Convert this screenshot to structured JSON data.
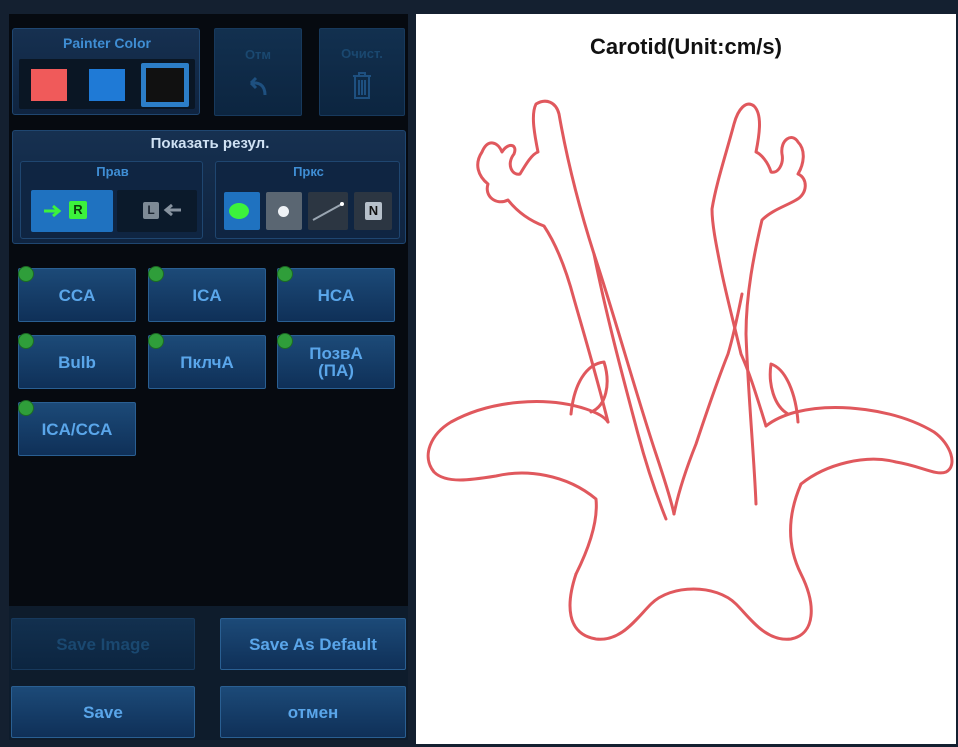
{
  "painter": {
    "title": "Painter Color",
    "swatches": [
      {
        "name": "red",
        "color": "#f05a5a",
        "selected": false
      },
      {
        "name": "blue",
        "color": "#1f7ad6",
        "selected": false
      },
      {
        "name": "black",
        "color": "#111111",
        "selected": true
      }
    ]
  },
  "toolbar": {
    "undo_label": "Отм",
    "clear_label": "Очист."
  },
  "show_results": {
    "title": "Показать резул.",
    "side_group": {
      "title": "Прав",
      "right_label": "R",
      "left_label": "L"
    },
    "mark_group": {
      "title": "Пркс",
      "n_label": "N"
    }
  },
  "vessels": [
    {
      "label": "CCA"
    },
    {
      "label": "ICA"
    },
    {
      "label": "HCA"
    },
    {
      "label": "Bulb"
    },
    {
      "label": "ПклчА"
    },
    {
      "label": "ПозвА\n(ПА)"
    },
    {
      "label": "ICA/CCA"
    }
  ],
  "actions": {
    "save_image": "Save Image",
    "save_default": "Save As Default",
    "save": "Save",
    "cancel": "отмен"
  },
  "diagram": {
    "title": "Carotid(Unit:cm/s)",
    "stroke": "#e0585d"
  }
}
